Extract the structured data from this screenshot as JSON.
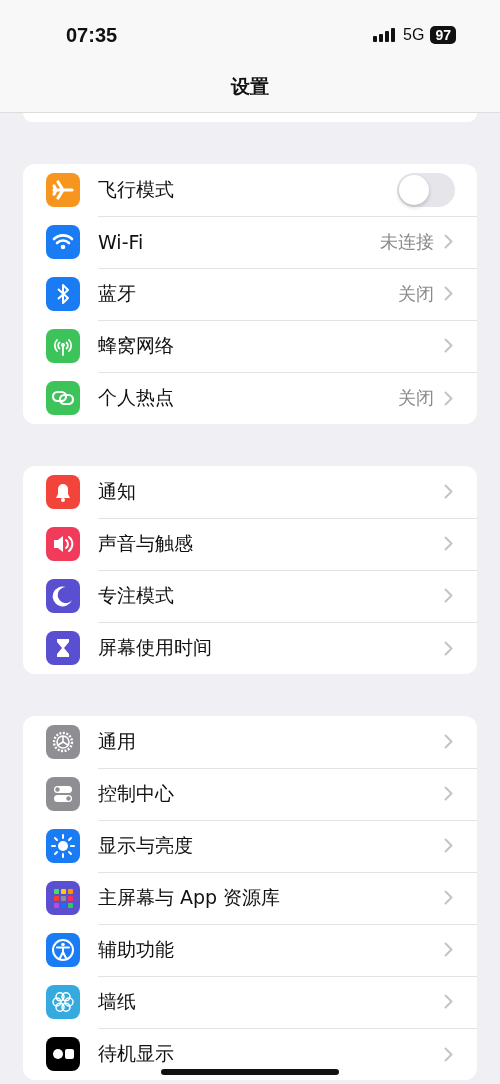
{
  "status_bar": {
    "time": "07:35",
    "network": "5G",
    "battery": "97"
  },
  "nav": {
    "title": "设置"
  },
  "groups": [
    {
      "items": [
        {
          "kind": "toggle",
          "label": "飞行模式",
          "color": "#f7961e",
          "on": false
        },
        {
          "kind": "link",
          "label": "Wi-Fi",
          "color": "#1a7cf5",
          "value": "未连接"
        },
        {
          "kind": "link",
          "label": "蓝牙",
          "color": "#1a7cf5",
          "value": "关闭"
        },
        {
          "kind": "link",
          "label": "蜂窝网络",
          "color": "#3cc45a"
        },
        {
          "kind": "link",
          "label": "个人热点",
          "color": "#3cc45a",
          "value": "关闭"
        }
      ]
    },
    {
      "items": [
        {
          "kind": "link",
          "label": "通知",
          "color": "#f2443a"
        },
        {
          "kind": "link",
          "label": "声音与触感",
          "color": "#f23a5a"
        },
        {
          "kind": "link",
          "label": "专注模式",
          "color": "#5a4fd0"
        },
        {
          "kind": "link",
          "label": "屏幕使用时间",
          "color": "#5a4fd0"
        }
      ]
    },
    {
      "items": [
        {
          "kind": "link",
          "label": "通用",
          "color": "#8e8e93"
        },
        {
          "kind": "link",
          "label": "控制中心",
          "color": "#8e8e93"
        },
        {
          "kind": "link",
          "label": "显示与亮度",
          "color": "#1a7cf5"
        },
        {
          "kind": "link",
          "label": "主屏幕与 App 资源库",
          "color": "#5a4fd0"
        },
        {
          "kind": "link",
          "label": "辅助功能",
          "color": "#1a7cf5"
        },
        {
          "kind": "link",
          "label": "墙纸",
          "color": "#35aadf"
        },
        {
          "kind": "link",
          "label": "待机显示",
          "color": "#000000"
        }
      ]
    }
  ]
}
